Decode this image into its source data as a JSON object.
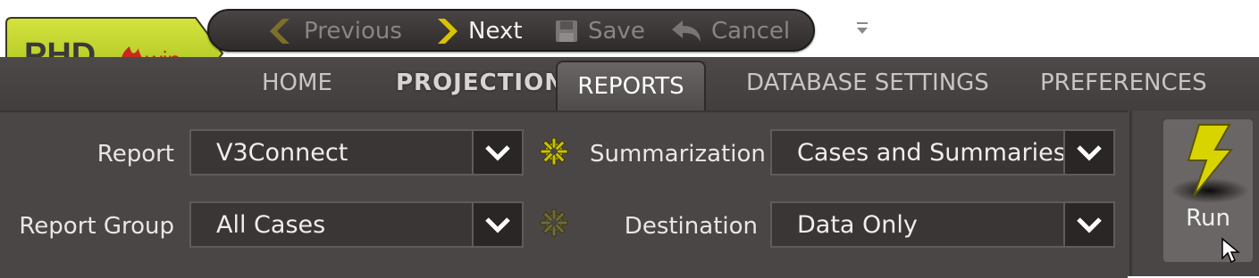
{
  "logo": {
    "text_left": "PHD",
    "text_right": "win"
  },
  "quickbar": {
    "previous_label": "Previous",
    "next_label": "Next",
    "save_label": "Save",
    "cancel_label": "Cancel"
  },
  "tabs": [
    {
      "label": "HOME"
    },
    {
      "label": "PROJECTIONS"
    },
    {
      "label": "REPORTS",
      "active": true
    },
    {
      "label": "DATABASE SETTINGS"
    },
    {
      "label": "PREFERENCES"
    }
  ],
  "fields": {
    "report": {
      "label": "Report",
      "value": "V3Connect"
    },
    "report_group": {
      "label": "Report Group",
      "value": "All Cases"
    },
    "summarization": {
      "label": "Summarization",
      "value": "Cases and Summaries"
    },
    "destination": {
      "label": "Destination",
      "value": "Data Only"
    }
  },
  "run": {
    "label": "Run"
  },
  "colors": {
    "accent_green": "#b8cf2b",
    "bolt_yellow": "#d8d400",
    "band": "#4b4646"
  }
}
